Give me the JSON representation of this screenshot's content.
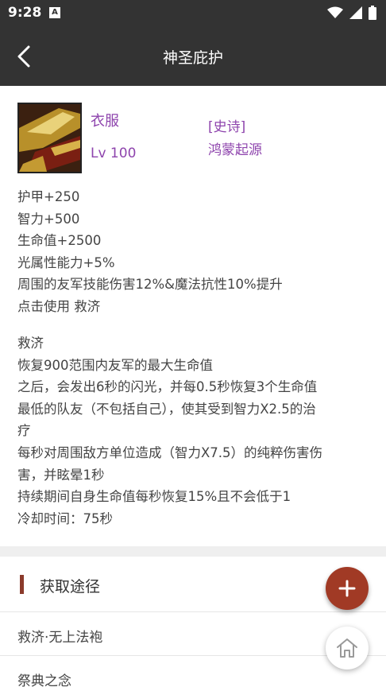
{
  "status_bar": {
    "time": "9:28",
    "notification_icon": "A"
  },
  "appbar": {
    "title": "神圣庇护",
    "back_icon": "chevron-left"
  },
  "item": {
    "name": "衣服",
    "level": "Lv 100",
    "rarity": "[史诗]",
    "set_name": "鸿蒙起源"
  },
  "stats": [
    "护甲+250",
    "智力+500",
    "生命值+2500",
    "光属性能力+5%",
    "周围的友军技能伤害12%&魔法抗性10%提升",
    "点击使用 救济"
  ],
  "skill": {
    "name": "救济",
    "lines": [
      "恢复900范围内友军的最大生命值",
      "之后，会发出6秒的闪光，并每0.5秒恢复3个生命值",
      "最低的队友（不包括自己），使其受到智力X2.5的治",
      "疗",
      "每秒对周围敌方单位造成（智力X7.5）的纯粹伤害伤",
      "害，并眩晕1秒",
      "持续期间自身生命值每秒恢复15%且不会低于1",
      "冷却时间：75秒"
    ]
  },
  "acquisition": {
    "title": "获取途径",
    "items": [
      "救济·无上法袍",
      "祭典之念"
    ]
  },
  "colors": {
    "accent": "#a13a25",
    "epic": "#8e44ad",
    "header_bg": "#333333"
  }
}
